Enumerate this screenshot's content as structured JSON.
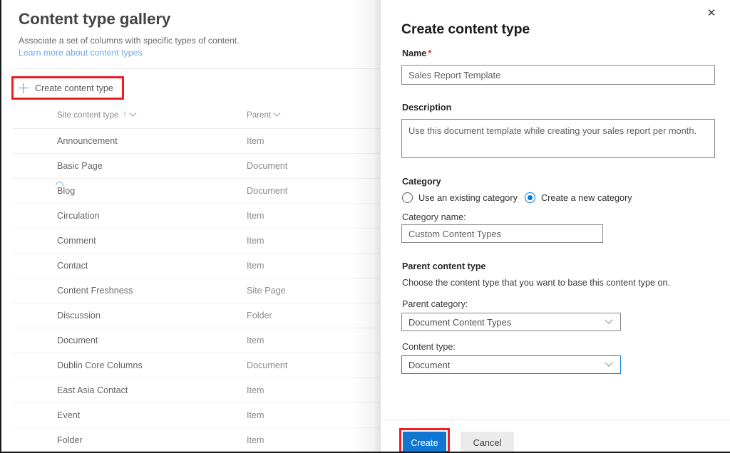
{
  "gallery": {
    "title": "Content type gallery",
    "subtitle": "Associate a set of columns with specific types of content.",
    "learn_more_link": "Learn more about content types",
    "create_button_label": "Create content type",
    "columns": {
      "name": "Site content type",
      "parent": "Parent",
      "sort_indicator": "↑"
    },
    "rows": [
      {
        "name": "Announcement",
        "parent": "Item",
        "loading": false
      },
      {
        "name": "Basic Page",
        "parent": "Document",
        "loading": false
      },
      {
        "name": "Blog",
        "parent": "Document",
        "loading": true
      },
      {
        "name": "Circulation",
        "parent": "Item",
        "loading": false
      },
      {
        "name": "Comment",
        "parent": "Item",
        "loading": false
      },
      {
        "name": "Contact",
        "parent": "Item",
        "loading": false
      },
      {
        "name": "Content Freshness",
        "parent": "Site Page",
        "loading": false
      },
      {
        "name": "Discussion",
        "parent": "Folder",
        "loading": false
      },
      {
        "name": "Document",
        "parent": "Item",
        "loading": false
      },
      {
        "name": "Dublin Core Columns",
        "parent": "Document",
        "loading": false
      },
      {
        "name": "East Asia Contact",
        "parent": "Item",
        "loading": false
      },
      {
        "name": "Event",
        "parent": "Item",
        "loading": false
      },
      {
        "name": "Folder",
        "parent": "Item",
        "loading": false
      }
    ]
  },
  "panel": {
    "title": "Create content type",
    "close_icon": "close-icon",
    "name": {
      "label": "Name",
      "required_marker": "*",
      "value": "Sales Report Template"
    },
    "description": {
      "label": "Description",
      "value": "Use this document template while creating your sales report per month."
    },
    "category": {
      "label": "Category",
      "option_existing": "Use an existing category",
      "option_new": "Create a new category",
      "selected": "Create a new category",
      "name_label": "Category name:",
      "name_value": "Custom Content Types"
    },
    "parent_content_type": {
      "label": "Parent content type",
      "description": "Choose the content type that you want to base this content type on.",
      "parent_category_label": "Parent category:",
      "parent_category_value": "Document Content Types",
      "content_type_label": "Content type:",
      "content_type_value": "Document"
    },
    "footer": {
      "create_label": "Create",
      "cancel_label": "Cancel"
    }
  },
  "colors": {
    "accent": "#0078d4",
    "primary_button": "#0f76d1",
    "annotation": "#ee1c25",
    "link": "#6aa9e9",
    "required": "#d13438"
  }
}
